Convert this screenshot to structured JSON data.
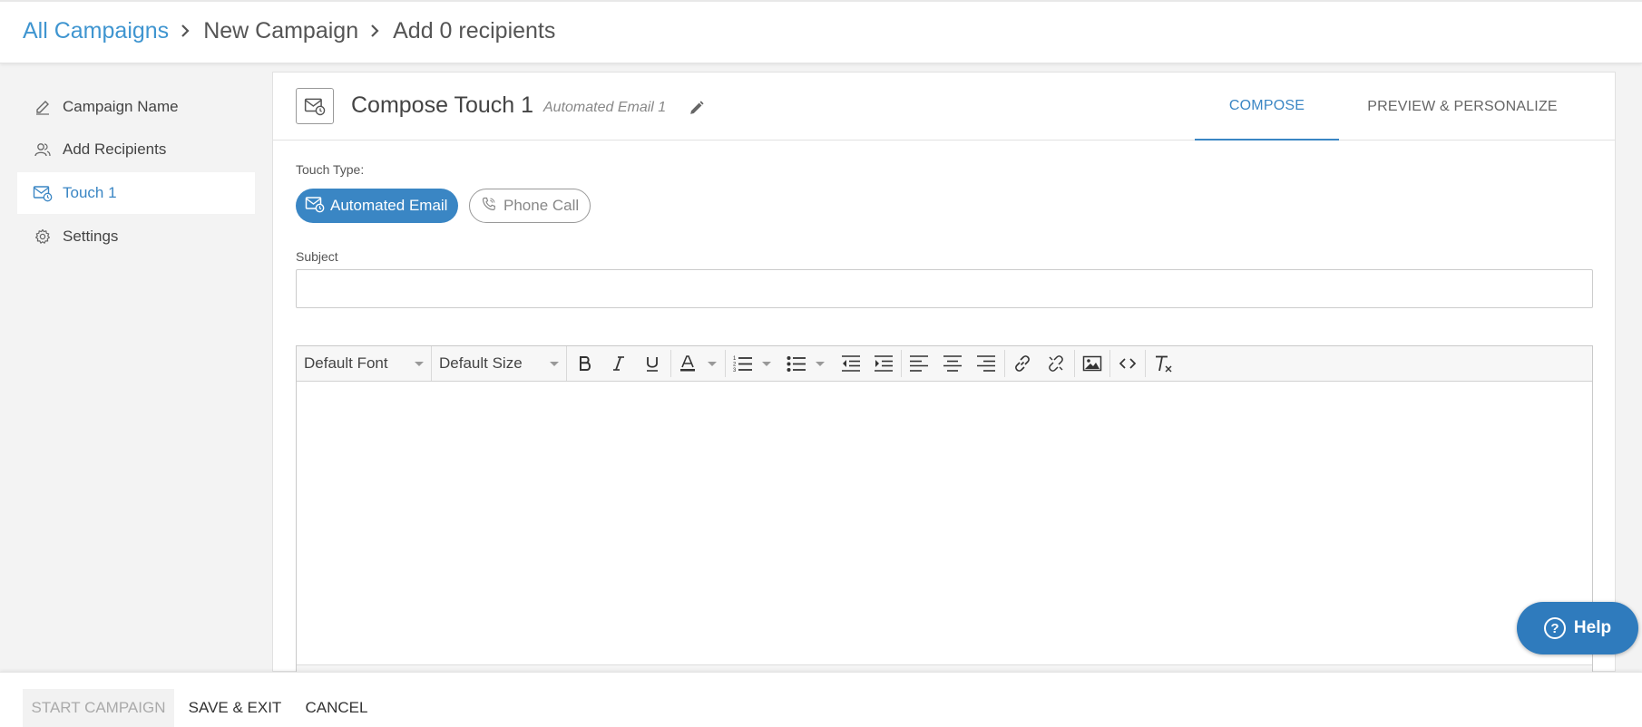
{
  "breadcrumb": {
    "items": [
      "All Campaigns",
      "New Campaign",
      "Add 0 recipients"
    ]
  },
  "sidebar": {
    "items": [
      {
        "label": "Campaign Name",
        "icon": "pencil-icon"
      },
      {
        "label": "Add Recipients",
        "icon": "users-icon"
      },
      {
        "label": "Touch 1",
        "icon": "email-clock-icon",
        "active": true
      },
      {
        "label": "Settings",
        "icon": "gear-icon"
      }
    ]
  },
  "header": {
    "title": "Compose Touch 1",
    "subtitle": "Automated Email 1",
    "tabs": [
      {
        "label": "COMPOSE",
        "active": true
      },
      {
        "label": "PREVIEW & PERSONALIZE"
      }
    ]
  },
  "form": {
    "touch_type_label": "Touch Type:",
    "touch_types": [
      "Automated Email",
      "Phone Call"
    ],
    "selected_touch_type": "Automated Email",
    "subject_label": "Subject",
    "subject_value": ""
  },
  "editor": {
    "font": "Default Font",
    "size": "Default Size"
  },
  "help": {
    "label": "Help"
  },
  "footer": {
    "start_label": "START CAMPAIGN",
    "save_label": "SAVE & EXIT",
    "cancel_label": "CANCEL"
  },
  "colors": {
    "accent": "#3a86c4",
    "link": "#3f95d0",
    "help_bg": "#2f7bbd"
  }
}
